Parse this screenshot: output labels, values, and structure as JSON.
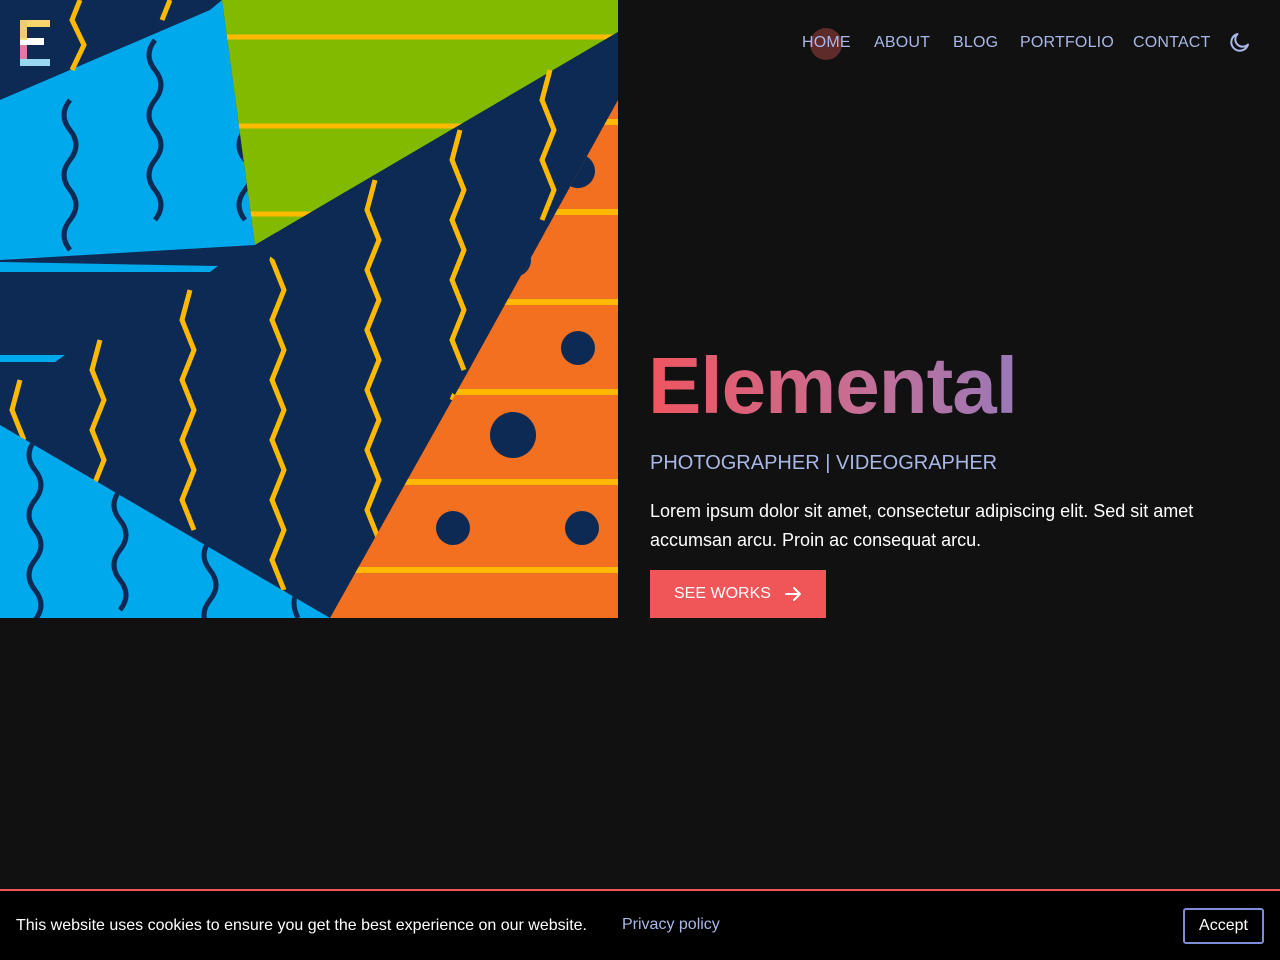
{
  "brand": {
    "logo_letter": "E",
    "logo_colors": [
      "#f5d76e",
      "#e57aa0",
      "#9ad7f0",
      "#ffffff"
    ]
  },
  "nav": {
    "items": [
      {
        "label": "HOME",
        "active": true
      },
      {
        "label": "ABOUT",
        "active": false
      },
      {
        "label": "BLOG",
        "active": false
      },
      {
        "label": "PORTFOLIO",
        "active": false
      },
      {
        "label": "CONTACT",
        "active": false
      }
    ],
    "theme_toggle_icon": "moon-icon"
  },
  "hero": {
    "title": "Elemental",
    "subtitle": "PHOTOGRAPHER | VIDEOGRAPHER",
    "description": "Lorem ipsum dolor sit amet, consectetur adipiscing elit. Sed sit amet accumsan arcu. Proin ac consequat arcu.",
    "cta_label": "SEE WORKS",
    "cta_icon": "arrow-right-icon"
  },
  "cookie_banner": {
    "message": "This website uses cookies to ensure you get the best experience on our website.",
    "link_label": "Privacy policy",
    "accept_label": "Accept"
  },
  "colors": {
    "background": "#111111",
    "accent": "#f05558",
    "link": "#a9b8e8",
    "art_navy": "#0c2a54",
    "art_blue": "#00a8ec",
    "art_green": "#82ba00",
    "art_orange": "#f37021",
    "art_yellow": "#ffb900"
  }
}
